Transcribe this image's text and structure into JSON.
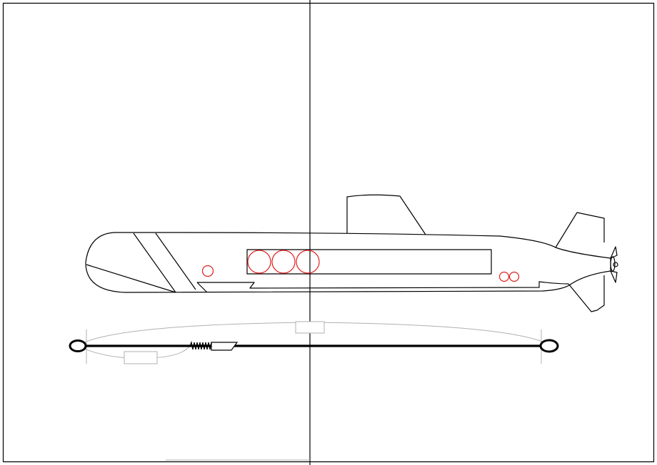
{
  "drawing": {
    "colors": {
      "line": "#000000",
      "highlight": "#e02020",
      "dimension": "#b0b0b0",
      "background": "#ffffff"
    },
    "components": [
      "frame-border",
      "center-line",
      "submarine-hull",
      "sail",
      "tail-fin",
      "propeller",
      "torpedo-tubes",
      "small-porthole",
      "twin-portholes",
      "keel-fairings",
      "cable-rod",
      "spring",
      "dimension-arc",
      "dimension-boxes"
    ]
  }
}
